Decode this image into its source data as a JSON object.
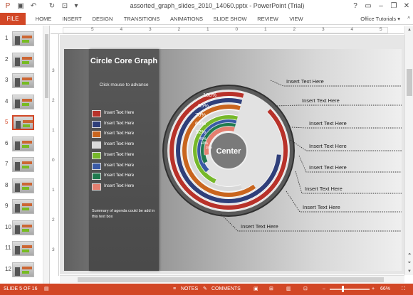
{
  "window": {
    "title": "assorted_graph_slides_2010_14060.pptx - PowerPoint (Trial)",
    "help": "?",
    "minimize": "–",
    "restore": "❐",
    "close": "✕"
  },
  "ribbon": {
    "file": "FILE",
    "tabs": [
      "HOME",
      "INSERT",
      "DESIGN",
      "TRANSITIONS",
      "ANIMATIONS",
      "SLIDE SHOW",
      "REVIEW",
      "VIEW"
    ],
    "account": "Office Tutorials ▾",
    "collapse": "^"
  },
  "thumbnails": {
    "numbers": [
      "1",
      "2",
      "3",
      "4",
      "5",
      "6",
      "7",
      "8",
      "9",
      "10",
      "11",
      "12"
    ],
    "active_index": 4
  },
  "ruler": {
    "h_ticks": [
      "5",
      "4",
      "3",
      "2",
      "1",
      "0",
      "1",
      "2",
      "3",
      "4",
      "5"
    ],
    "v_ticks": [
      "3",
      "2",
      "1",
      "0",
      "1",
      "2",
      "3"
    ]
  },
  "slide": {
    "title": "Circle Core Graph",
    "subtitle": "Click mouse to advance",
    "legend": [
      {
        "label": "Insert Text Here",
        "color": "#b8322a"
      },
      {
        "label": "Insert Text Here",
        "color": "#2f3f7a"
      },
      {
        "label": "Insert Text Here",
        "color": "#c9651e"
      },
      {
        "label": "Insert Text Here",
        "color": "#d9d9d9"
      },
      {
        "label": "Insert Text Here",
        "color": "#76b82a"
      },
      {
        "label": "Insert Text Here",
        "color": "#3a5aa6"
      },
      {
        "label": "Insert Text Here",
        "color": "#1f7a4e"
      },
      {
        "label": "Insert Text Here",
        "color": "#e57f70"
      }
    ],
    "summary": "Summary of agenda could be add in this text box",
    "center_label": "Center",
    "percent_labels": [
      "100%",
      "85%",
      "70%",
      "65%",
      "52%",
      "45%",
      "40%",
      "35%"
    ],
    "callouts": [
      "Insert Text Here",
      "Insert Text Here",
      "Insert Text Here",
      "Insert Text Here",
      "Insert Text Here",
      "Insert Text Here",
      "Insert Text Here",
      "Insert Text Here"
    ]
  },
  "chart_data": {
    "type": "radial-bar",
    "center": "Center",
    "series": [
      {
        "name": "Insert Text Here",
        "value": 100,
        "color": "#b8322a"
      },
      {
        "name": "Insert Text Here",
        "value": 85,
        "color": "#2f3f7a"
      },
      {
        "name": "Insert Text Here",
        "value": 70,
        "color": "#c9651e"
      },
      {
        "name": "Insert Text Here",
        "value": 65,
        "color": "#d9d9d9"
      },
      {
        "name": "Insert Text Here",
        "value": 52,
        "color": "#76b82a"
      },
      {
        "name": "Insert Text Here",
        "value": 45,
        "color": "#3a5aa6"
      },
      {
        "name": "Insert Text Here",
        "value": 40,
        "color": "#1f7a4e"
      },
      {
        "name": "Insert Text Here",
        "value": 35,
        "color": "#e57f70"
      }
    ]
  },
  "status": {
    "slide": "SLIDE 5 OF 16",
    "notes": "NOTES",
    "comments": "COMMENTS",
    "zoom": "66%"
  }
}
